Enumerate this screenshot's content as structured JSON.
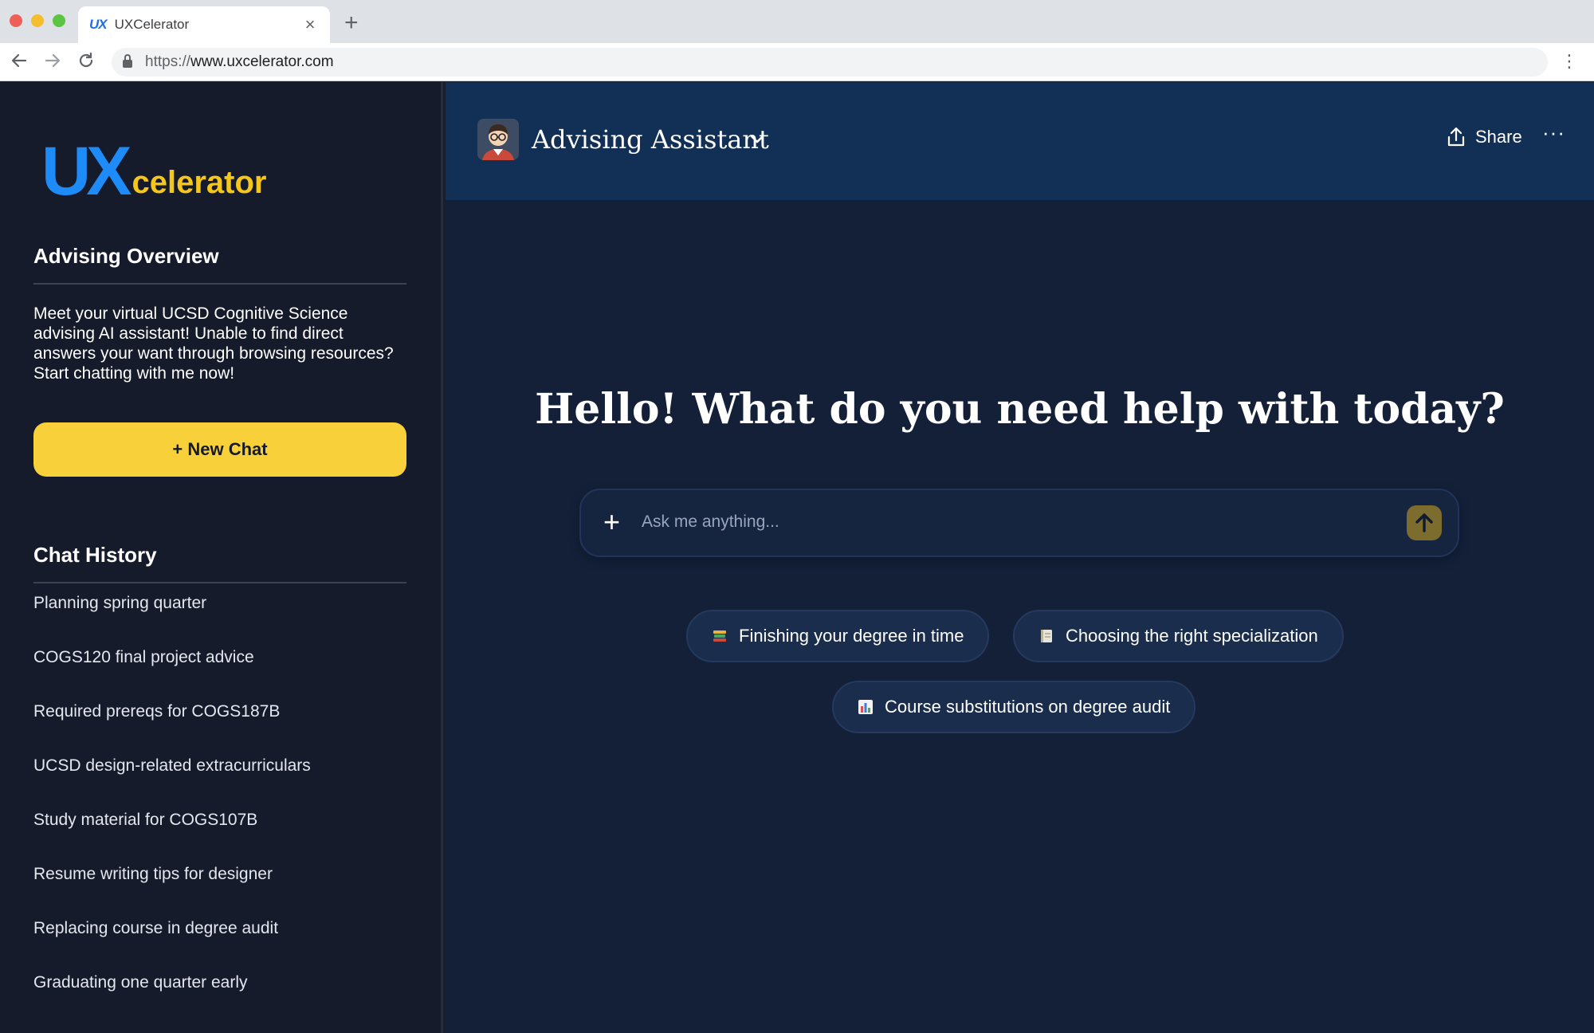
{
  "browser": {
    "tab_title": "UXCelerator",
    "tab_favicon": "UX",
    "url_protocol": "https://",
    "url_host": "www.uxcelerator.com",
    "traffic_light_colors": [
      "#ee5f57",
      "#f5be2f",
      "#5bc443"
    ]
  },
  "sidebar": {
    "logo_ux": "UX",
    "logo_rest": "celerator",
    "overview_heading": "Advising Overview",
    "overview_text": "Meet your virtual UCSD Cognitive Science advising AI assistant! Unable to find direct answers your want through browsing resources? Start chatting with me now!",
    "new_chat_label": "+ New Chat",
    "history_heading": "Chat History",
    "history": [
      "Planning spring quarter",
      "COGS120 final project advice",
      "Required prereqs for COGS187B",
      "UCSD design-related extracurriculars",
      "Study material for COGS107B",
      "Resume writing tips for designer",
      "Replacing course in degree audit",
      "Graduating one quarter early"
    ]
  },
  "header": {
    "assistant_title": "Advising Assistant",
    "share_label": "Share"
  },
  "main": {
    "greeting": "Hello! What do you need help with today?",
    "input_placeholder": "Ask me anything...",
    "suggestions": [
      {
        "label": "Finishing your degree in time",
        "icon": "books-icon"
      },
      {
        "label": "Choosing the right specialization",
        "icon": "notebook-icon"
      },
      {
        "label": "Course substitutions on degree audit",
        "icon": "bar-chart-icon"
      }
    ]
  },
  "colors": {
    "accent_yellow": "#f8d13a",
    "logo_blue": "#1d8cf8",
    "sidebar_bg": "#161b2b",
    "header_bg": "#123056",
    "main_bg": "#132038"
  }
}
